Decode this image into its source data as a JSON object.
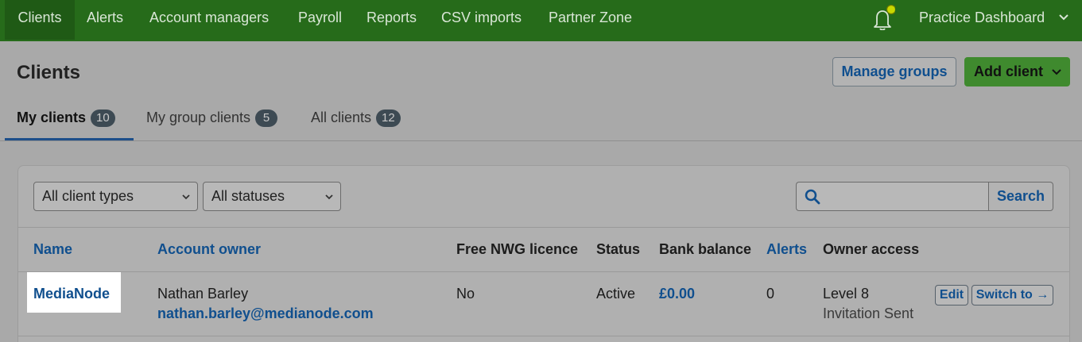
{
  "topnav": {
    "items": [
      {
        "label": "Clients",
        "active": true
      },
      {
        "label": "Alerts"
      },
      {
        "label": "Account managers"
      },
      {
        "label": "Payroll"
      },
      {
        "label": "Reports"
      },
      {
        "label": "CSV imports"
      },
      {
        "label": "Partner Zone"
      }
    ],
    "bell_icon": "bell-icon",
    "practice_label": "Practice Dashboard"
  },
  "header": {
    "title": "Clients",
    "manage_groups_label": "Manage groups",
    "add_client_label": "Add client"
  },
  "tabs": [
    {
      "label": "My clients",
      "count": "10",
      "active": true
    },
    {
      "label": "My group clients",
      "count": "5"
    },
    {
      "label": "All clients",
      "count": "12"
    }
  ],
  "filters": {
    "client_type": "All client types",
    "status": "All statuses",
    "search_placeholder": "",
    "search_button": "Search"
  },
  "table": {
    "columns": [
      "Name",
      "Account owner",
      "Free NWG licence",
      "Status",
      "Bank balance",
      "Alerts",
      "Owner access"
    ],
    "rows": [
      {
        "name": "MediaNode",
        "owner_name": "Nathan Barley",
        "owner_email": "nathan.barley@medianode.com",
        "free_licence": "No",
        "status": "Active",
        "bank_balance": "£0.00",
        "alerts": "0",
        "access_level": "Level 8",
        "access_note": "Invitation Sent",
        "edit_label": "Edit",
        "switch_label": "Switch to →"
      }
    ]
  },
  "colors": {
    "nav_bg": "#266b1a",
    "link": "#104f8e",
    "primary_button": "#3f8a2e",
    "badge": "#3d4a53"
  }
}
